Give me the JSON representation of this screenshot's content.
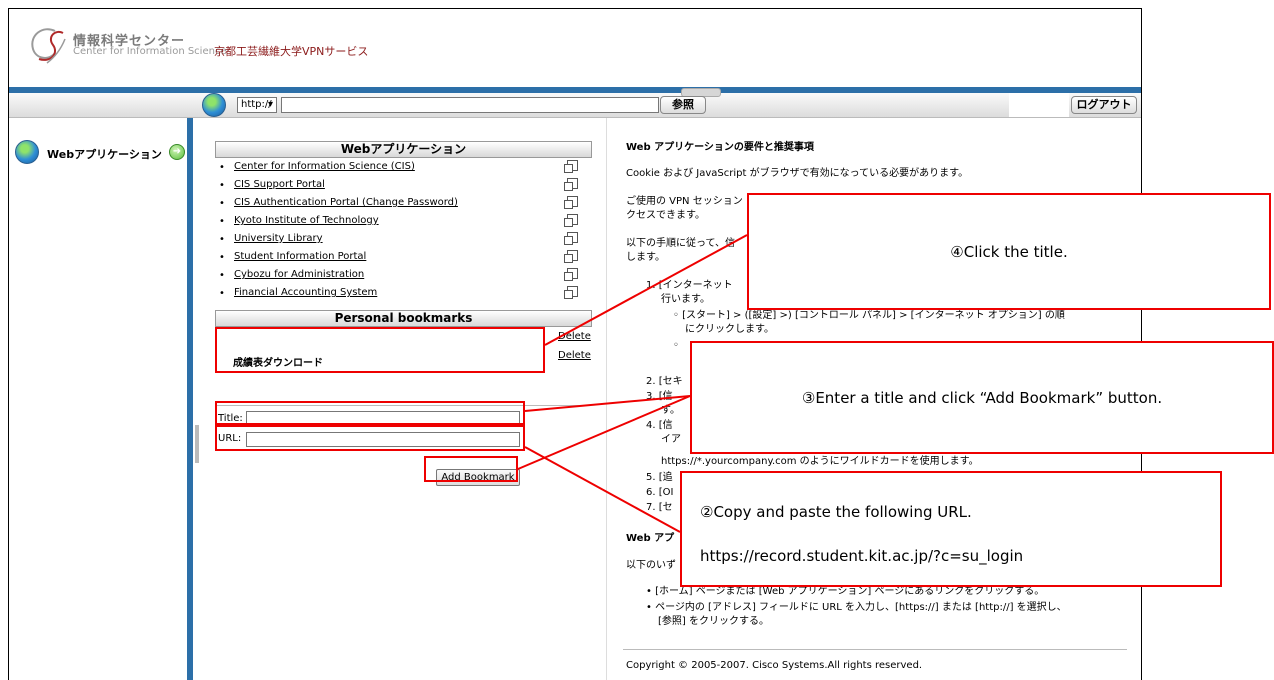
{
  "header": {
    "logo_jp": "情報科学センター",
    "logo_en": "Center for Information Science",
    "service_title": "京都工芸繊維大学VPNサービス"
  },
  "navbar": {
    "protocol": "http://",
    "browse_label": "参照",
    "logout_label": "ログアウト"
  },
  "sidebar": {
    "items": [
      {
        "label": "Webアプリケーション"
      }
    ]
  },
  "web_apps": {
    "title": "Webアプリケーション",
    "items": [
      "Center for Information Science (CIS)",
      "CIS Support Portal",
      "CIS Authentication Portal (Change Password)",
      "Kyoto Institute of Technology",
      "University Library",
      "Student Information Portal",
      "Cybozu for Administration",
      "Financial Accounting System"
    ]
  },
  "bookmarks": {
    "title": "Personal bookmarks",
    "item": "成績表ダウンロード",
    "delete_label": "Delete"
  },
  "form": {
    "title_label": "Title:",
    "url_label": "URL:",
    "add_button": "Add Bookmark"
  },
  "right": {
    "heading": "Web アプリケーションの要件と推奨事項",
    "p1": "Cookie および JavaScript がブラウザで有効になっている必要があります。",
    "p2a": "ご使用の VPN セッション",
    "p2b": "クセスできます。",
    "p3a": "以下の手順に従って、信",
    "p3b": "します。",
    "s1a": "1. [インターネット",
    "s1b": "行います。",
    "s1c": "◦ [スタート] > ([設定] >) [コントロール パネル] > [インターネット オプション] の順",
    "s1d": "にクリックします。",
    "s1e": "◦",
    "s2": "2. [セキ",
    "s3": "3. [信",
    "s3b": "す。",
    "s4": "4. [信",
    "s4b": "イア",
    "s4c": "https://*.yourcompany.com のようにワイルドカードを使用します。",
    "s5": "5. [追",
    "s6": "6. [OI",
    "s7": "7. [セ",
    "h2": "Web アプ",
    "p4": "以下のいず",
    "b1": "• [ホーム] ページまたは [Web アプリケーション] ページにあるリンクをクリックする。",
    "b2a": "• ページ内の [アドレス] フィールドに URL を入力し、[https://] または [http://] を選択し、",
    "b2b": "[参照] をクリックする。",
    "copyright": "Copyright © 2005-2007. Cisco Systems.All rights reserved."
  },
  "callouts": {
    "c4": "④Click the title.",
    "c3": "③Enter a title and click “Add Bookmark” button.",
    "c2": "②Copy and paste the following URL.",
    "c2_url": "https://record.student.kit.ac.jp/?c=su_login"
  },
  "colors": {
    "accent": "#2c6fa8",
    "annotation": "#e00000",
    "brand": "#8b1a1a"
  }
}
